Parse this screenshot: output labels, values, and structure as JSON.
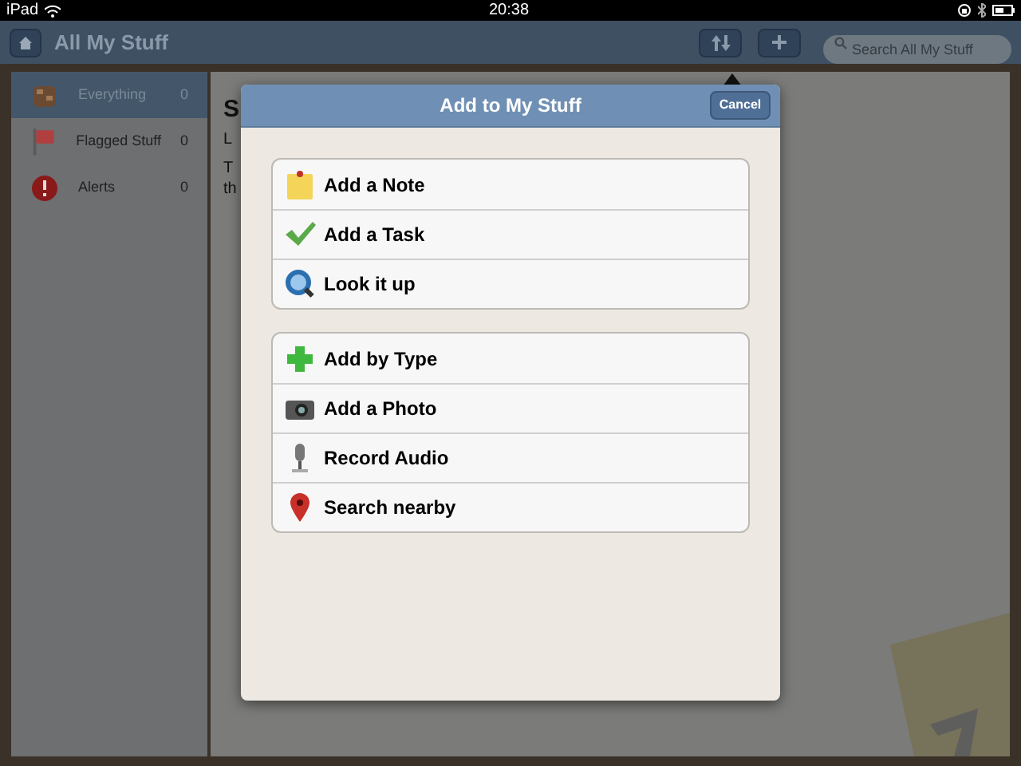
{
  "status_bar": {
    "device": "iPad",
    "time": "20:38"
  },
  "nav_bar": {
    "title": "All My Stuff",
    "search": {
      "placeholder": "Search All My Stuff"
    }
  },
  "sidebar": {
    "items": [
      {
        "kind": "everything",
        "label": "Everything",
        "count": "0",
        "selected": true
      },
      {
        "kind": "flag",
        "label": "Flagged Stuff",
        "count": "0",
        "selected": false
      },
      {
        "kind": "alert",
        "label": "Alerts",
        "count": "0",
        "selected": false
      }
    ]
  },
  "content": {
    "heading": "S",
    "lines": [
      "L",
      "T",
      "th"
    ]
  },
  "popover": {
    "title": "Add to My Stuff",
    "cancel": "Cancel",
    "groups": [
      [
        {
          "kind": "note",
          "label": "Add a Note"
        },
        {
          "kind": "task",
          "label": "Add a Task"
        },
        {
          "kind": "lookup",
          "label": "Look it up"
        }
      ],
      [
        {
          "kind": "type",
          "label": "Add by Type"
        },
        {
          "kind": "photo",
          "label": "Add a Photo"
        },
        {
          "kind": "audio",
          "label": "Record Audio"
        },
        {
          "kind": "nearby",
          "label": "Search nearby"
        }
      ]
    ]
  }
}
